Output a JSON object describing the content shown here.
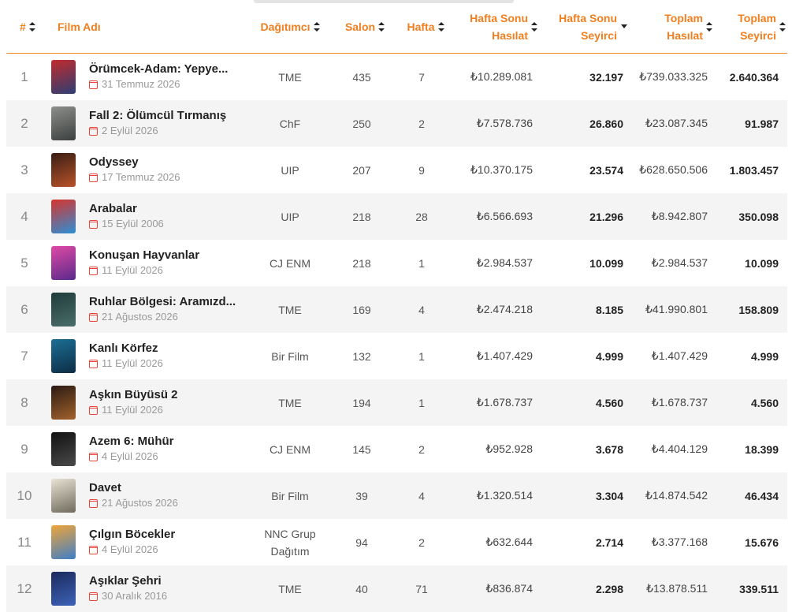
{
  "headers": {
    "rank": "#",
    "film": "Film Adı",
    "distributor": "Dağıtımcı",
    "screens": "Salon",
    "week": "Hafta",
    "weekend_gross_1": "Hafta Sonu",
    "weekend_gross_2": "Hasılat",
    "weekend_admissions_1": "Hafta Sonu",
    "weekend_admissions_2": "Seyirci",
    "total_gross_1": "Toplam",
    "total_gross_2": "Hasılat",
    "total_admissions_1": "Toplam",
    "total_admissions_2": "Seyirci"
  },
  "rows": [
    {
      "rank": "1",
      "title": "Örümcek-Adam: Yepye...",
      "date": "31 Temmuz 2026",
      "distributor": "TME",
      "screens": "435",
      "week": "7",
      "weekend_gross": "₺10.289.081",
      "weekend_admissions": "32.197",
      "total_gross": "₺739.033.325",
      "total_admissions": "2.640.364",
      "poster_colors": [
        "#c22b2b",
        "#2c3e75"
      ]
    },
    {
      "rank": "2",
      "title": "Fall 2: Ölümcül Tırmanış",
      "date": "2 Eylül 2026",
      "distributor": "ChF",
      "screens": "250",
      "week": "2",
      "weekend_gross": "₺7.578.736",
      "weekend_admissions": "26.860",
      "total_gross": "₺23.087.345",
      "total_admissions": "91.987",
      "poster_colors": [
        "#8d8f8c",
        "#3b3f3d"
      ]
    },
    {
      "rank": "3",
      "title": "Odyssey",
      "date": "17 Temmuz 2026",
      "distributor": "UIP",
      "screens": "207",
      "week": "9",
      "weekend_gross": "₺10.370.175",
      "weekend_admissions": "23.574",
      "total_gross": "₺628.650.506",
      "total_admissions": "1.803.457",
      "poster_colors": [
        "#3a1e14",
        "#b8532a"
      ]
    },
    {
      "rank": "4",
      "title": "Arabalar",
      "date": "15 Eylül 2006",
      "distributor": "UIP",
      "screens": "218",
      "week": "28",
      "weekend_gross": "₺6.566.693",
      "weekend_admissions": "21.296",
      "total_gross": "₺8.942.807",
      "total_admissions": "350.098",
      "poster_colors": [
        "#d8342c",
        "#2d8fd6"
      ]
    },
    {
      "rank": "5",
      "title": "Konuşan Hayvanlar",
      "date": "11 Eylül 2026",
      "distributor": "CJ ENM",
      "screens": "218",
      "week": "1",
      "weekend_gross": "₺2.984.537",
      "weekend_admissions": "10.099",
      "total_gross": "₺2.984.537",
      "total_admissions": "10.099",
      "poster_colors": [
        "#e049a6",
        "#5a2a8a"
      ]
    },
    {
      "rank": "6",
      "title": "Ruhlar Bölgesi: Aramızd...",
      "date": "21 Ağustos 2026",
      "distributor": "TME",
      "screens": "169",
      "week": "4",
      "weekend_gross": "₺2.474.218",
      "weekend_admissions": "8.185",
      "total_gross": "₺41.990.801",
      "total_admissions": "158.809",
      "poster_colors": [
        "#1f3b3a",
        "#4a6e6b"
      ]
    },
    {
      "rank": "7",
      "title": "Kanlı Körfez",
      "date": "11 Eylül 2026",
      "distributor": "Bir Film",
      "screens": "132",
      "week": "1",
      "weekend_gross": "₺1.407.429",
      "weekend_admissions": "4.999",
      "total_gross": "₺1.407.429",
      "total_admissions": "4.999",
      "poster_colors": [
        "#1c6f94",
        "#0d2c45"
      ]
    },
    {
      "rank": "8",
      "title": "Aşkın Büyüsü 2",
      "date": "11 Eylül 2026",
      "distributor": "TME",
      "screens": "194",
      "week": "1",
      "weekend_gross": "₺1.678.737",
      "weekend_admissions": "4.560",
      "total_gross": "₺1.678.737",
      "total_admissions": "4.560",
      "poster_colors": [
        "#2a1a12",
        "#a2622c"
      ]
    },
    {
      "rank": "9",
      "title": "Azem 6: Mühür",
      "date": "4 Eylül 2026",
      "distributor": "CJ ENM",
      "screens": "145",
      "week": "2",
      "weekend_gross": "₺952.928",
      "weekend_admissions": "3.678",
      "total_gross": "₺4.404.129",
      "total_admissions": "18.399",
      "poster_colors": [
        "#111111",
        "#4a4a4a"
      ]
    },
    {
      "rank": "10",
      "title": "Davet",
      "date": "21 Ağustos 2026",
      "distributor": "Bir Film",
      "screens": "39",
      "week": "4",
      "weekend_gross": "₺1.320.514",
      "weekend_admissions": "3.304",
      "total_gross": "₺14.874.542",
      "total_admissions": "46.434",
      "poster_colors": [
        "#e8e3d4",
        "#6e6a5c"
      ]
    },
    {
      "rank": "11",
      "title": "Çılgın Böcekler",
      "date": "4 Eylül 2026",
      "distributor": "NNC Grup Dağıtım",
      "screens": "94",
      "week": "2",
      "weekend_gross": "₺632.644",
      "weekend_admissions": "2.714",
      "total_gross": "₺3.377.168",
      "total_admissions": "15.676",
      "poster_colors": [
        "#f0a53a",
        "#3e7ec7"
      ]
    },
    {
      "rank": "12",
      "title": "Aşıklar Şehri",
      "date": "30 Aralık 2016",
      "distributor": "TME",
      "screens": "40",
      "week": "71",
      "weekend_gross": "₺836.874",
      "weekend_admissions": "2.298",
      "total_gross": "₺13.878.511",
      "total_admissions": "339.511",
      "poster_colors": [
        "#1b2a5c",
        "#3d62b8"
      ]
    }
  ],
  "colors": {
    "accent": "#f07f1f",
    "row_alt": "#f4f4f4",
    "calendar": "#e6463a"
  }
}
